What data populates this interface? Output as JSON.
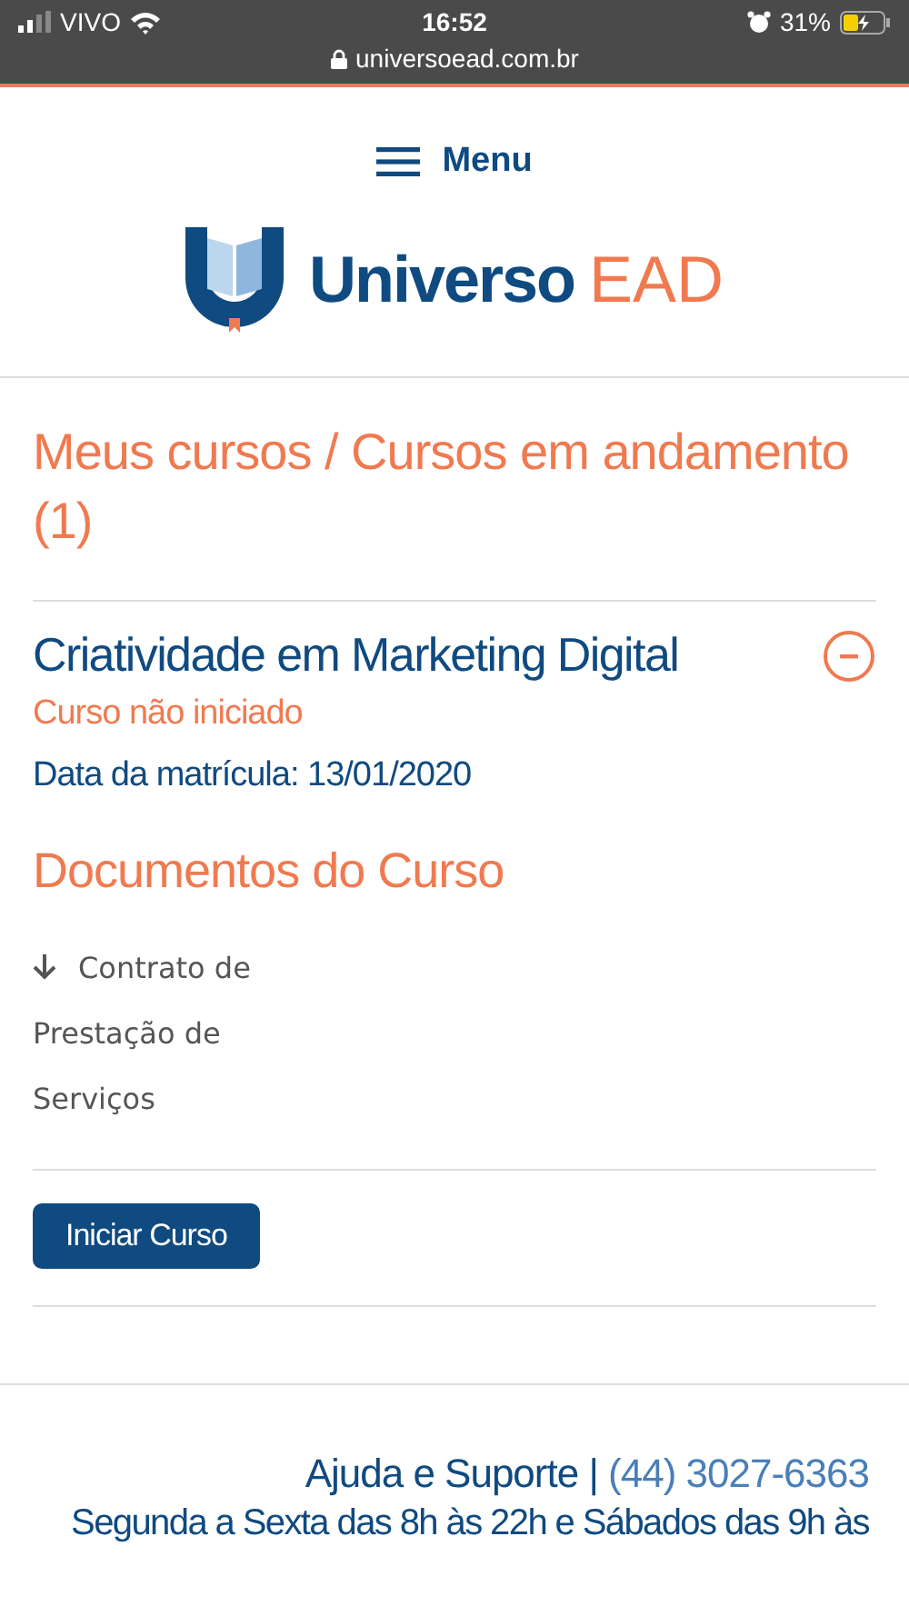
{
  "status_bar": {
    "carrier": "VIVO",
    "time": "16:52",
    "battery": "31%",
    "url": "universoead.com.br"
  },
  "menu": {
    "label": "Menu"
  },
  "logo": {
    "name": "Universo",
    "suffix": "EAD"
  },
  "heading": "Meus cursos / Cursos em andamento (1)",
  "course": {
    "title": "Criatividade em Marketing Digital",
    "expanded": true,
    "status": "Curso não iniciado",
    "enrollment": "Data da matrícula: 13/01/2020",
    "documents_title": "Documentos do Curso",
    "documents": [
      {
        "label": "Contrato de Prestação de Serviços"
      }
    ],
    "button": "Iniciar Curso"
  },
  "footer": {
    "support": "Ajuda e Suporte |",
    "phone": "(44) 3027-6363",
    "hours": "Segunda a Sexta das 8h às 22h e Sábados das 9h às"
  }
}
